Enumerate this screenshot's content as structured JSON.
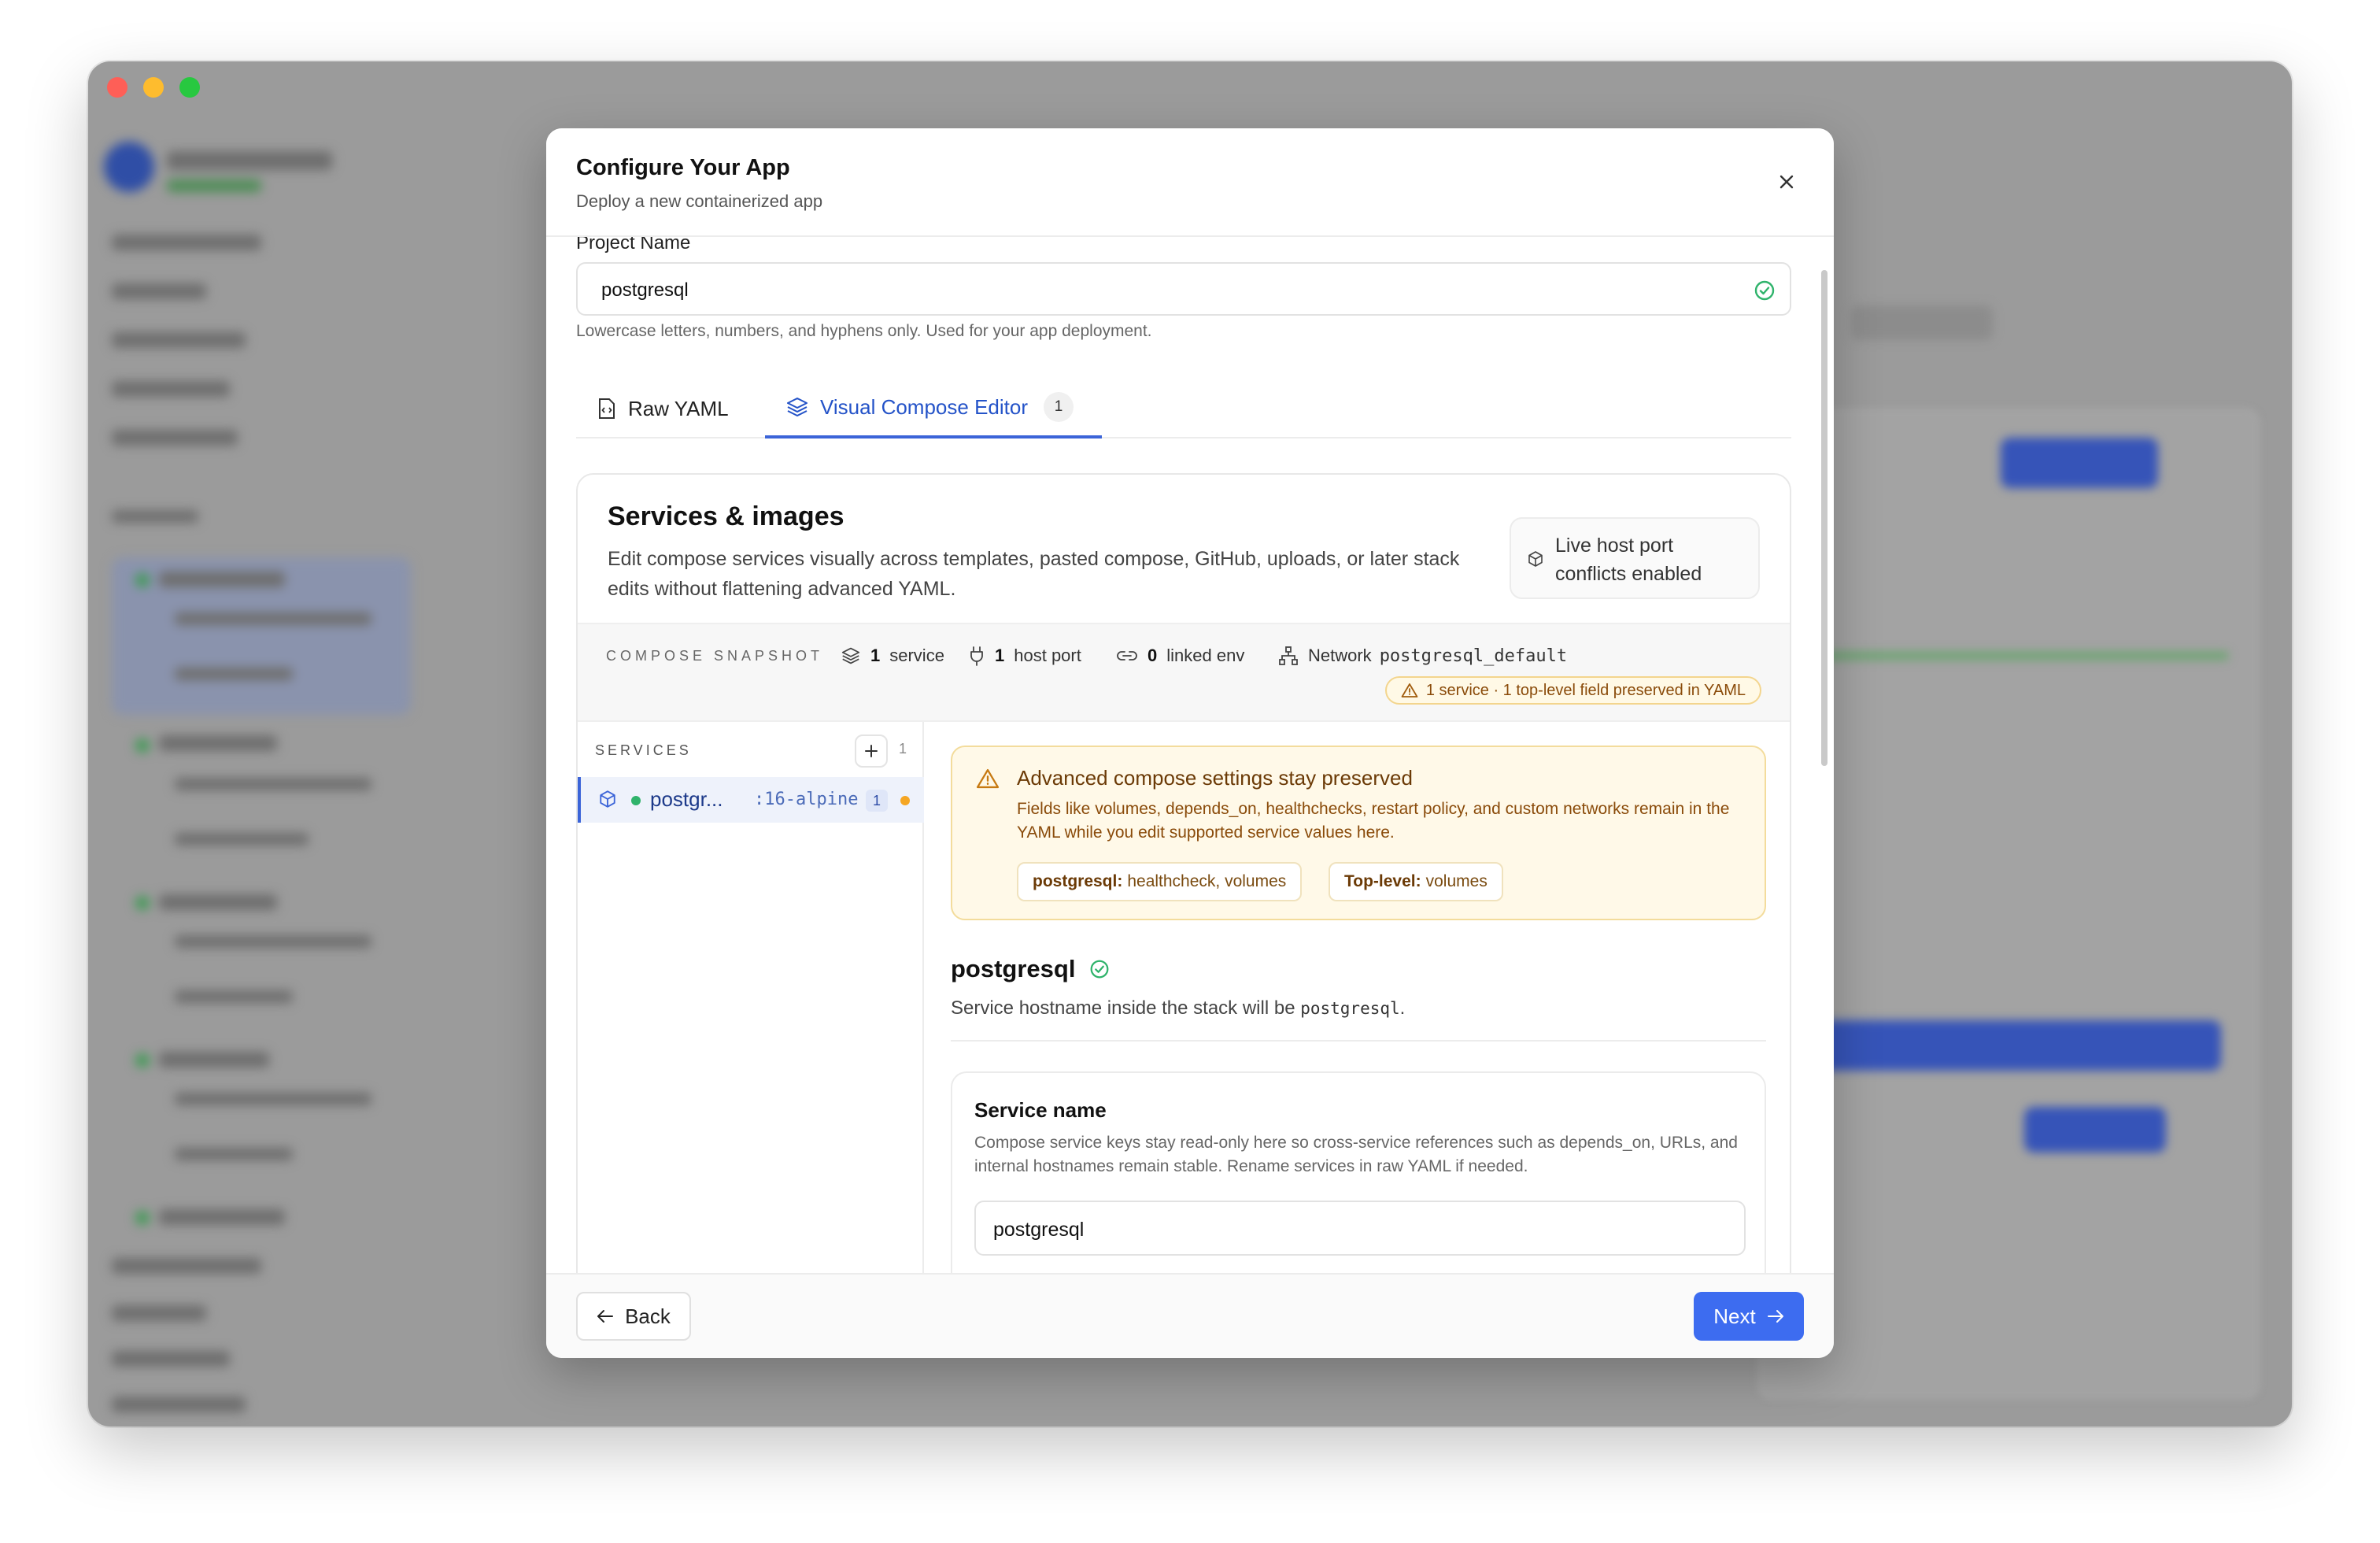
{
  "modal": {
    "title": "Configure Your App",
    "subtitle": "Deploy a new containerized app"
  },
  "project": {
    "label": "Project Name",
    "value": "postgresql",
    "helper": "Lowercase letters, numbers, and hyphens only. Used for your app deployment."
  },
  "tabs": {
    "raw": "Raw YAML",
    "visual": "Visual Compose Editor",
    "visual_badge": "1",
    "active": "Visual Compose Editor"
  },
  "card": {
    "title": "Services & images",
    "description": "Edit compose services visually across templates, pasted compose, GitHub, uploads, or later stack edits without flattening advanced YAML.",
    "live_badge": "Live host port conflicts enabled"
  },
  "snapshot": {
    "label": "COMPOSE SNAPSHOT",
    "services_count": "1",
    "services_label": "service",
    "host_ports_count": "1",
    "host_ports_label": "host port",
    "linked_env_count": "0",
    "linked_env_label": "linked env",
    "network_label": "Network",
    "network_value": "postgresql_default",
    "warning": "1 service · 1 top-level field preserved in YAML"
  },
  "services": {
    "heading": "SERVICES",
    "count": "1",
    "items": [
      {
        "name": "postgr...",
        "tag": ":16-alpine",
        "badge": "1"
      }
    ]
  },
  "advanced": {
    "title": "Advanced compose settings stay preserved",
    "description": "Fields like volumes, depends_on, healthchecks, restart policy, and custom networks remain in the YAML while you edit supported service values here.",
    "chip1_key": "postgresql:",
    "chip1_value": "healthcheck, volumes",
    "chip2_key": "Top-level:",
    "chip2_value": "volumes"
  },
  "service_detail": {
    "name": "postgresql",
    "hostname_prefix": "Service hostname inside the stack will be",
    "hostname": "postgresql",
    "hostname_suffix": ".",
    "name_card_title": "Service name",
    "name_card_desc": "Compose service keys stay read-only here so cross-service references such as depends_on, URLs, and internal hostnames remain stable. Rename services in raw YAML if needed.",
    "name_value": "postgresql"
  },
  "footer": {
    "back": "Back",
    "next": "Next"
  },
  "colors": {
    "accent": "#3d6cf0",
    "tab_active": "#2453c8",
    "success": "#2fb36b",
    "warning_bg": "#fff9e8",
    "warning_text": "#8a4b0a"
  }
}
